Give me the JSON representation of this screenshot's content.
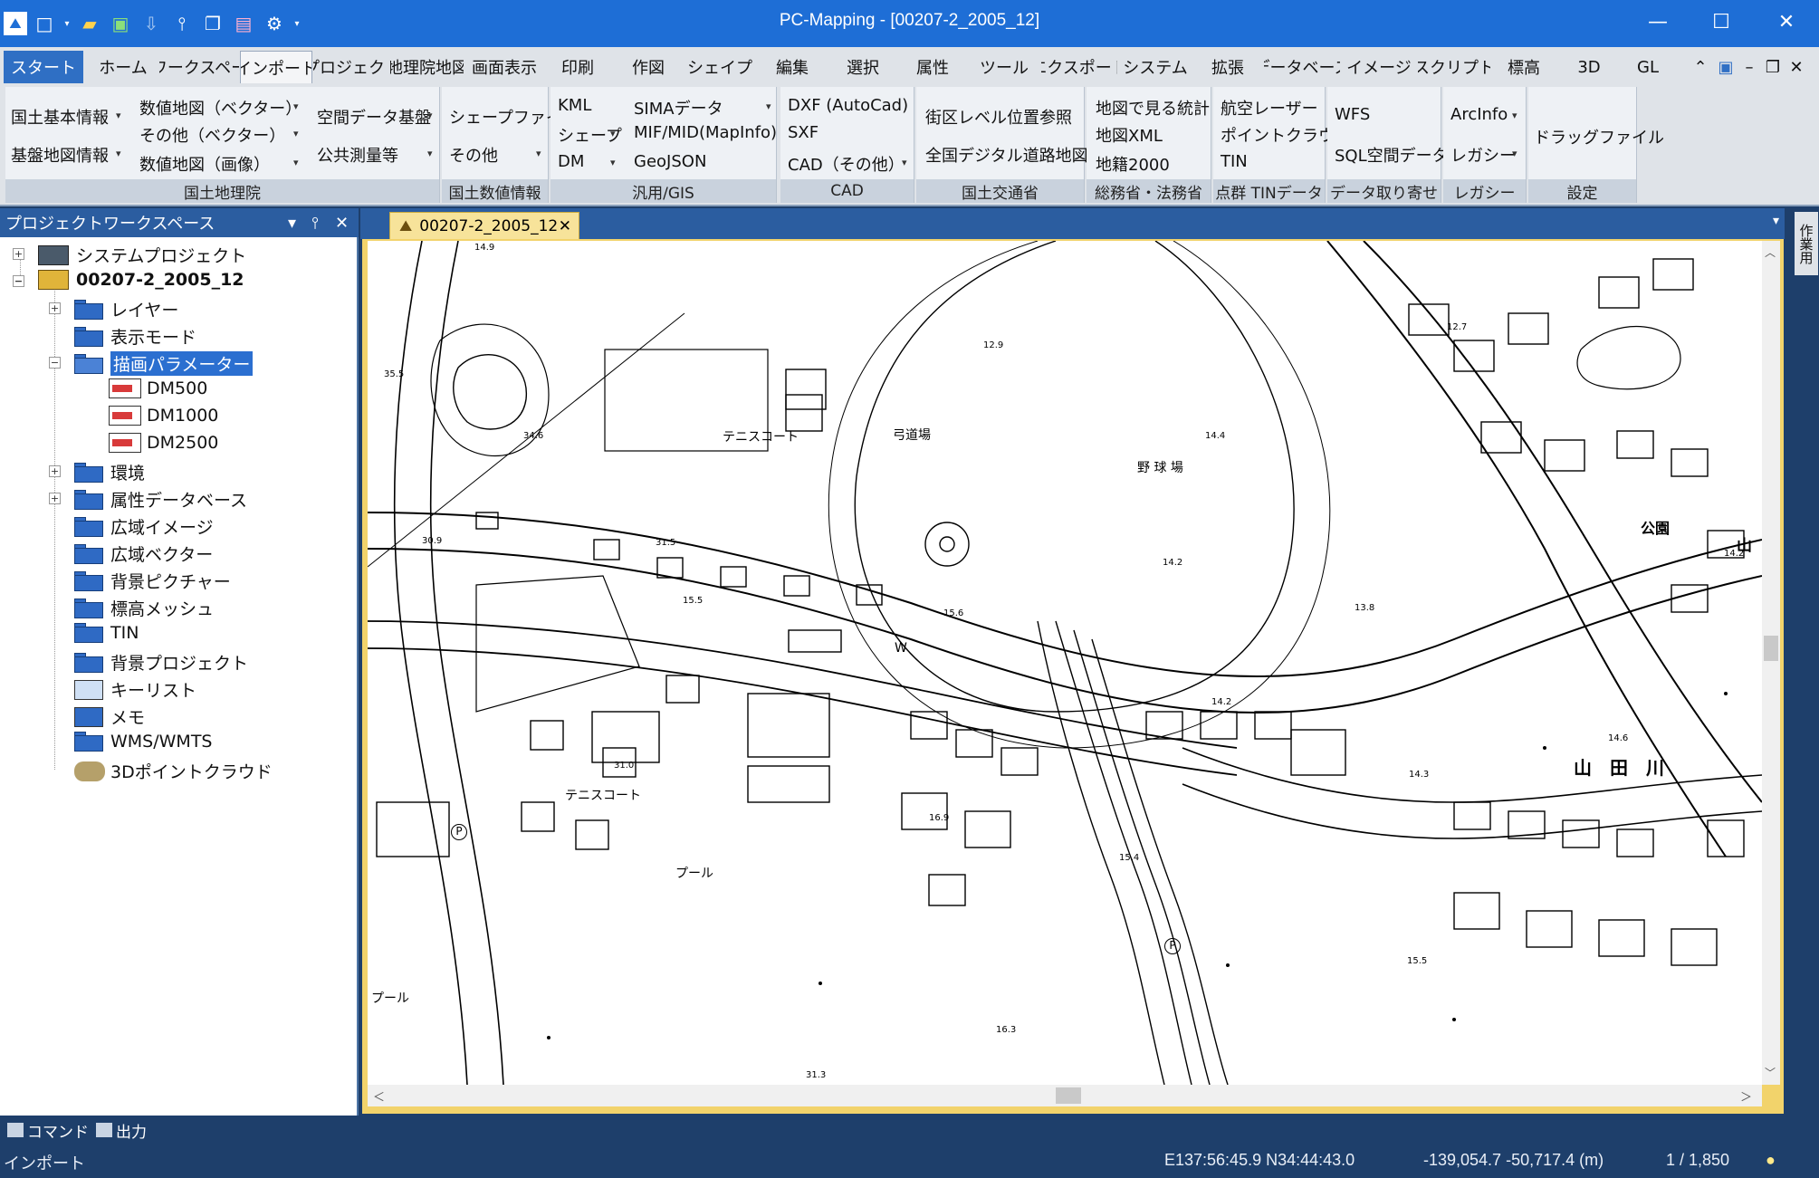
{
  "window": {
    "title": "PC-Mapping - [00207-2_2005_12]"
  },
  "qat": [
    "app-logo-icon",
    "new-file-icon",
    "open-folder-icon",
    "excel-icon",
    "download-icon",
    "pin-icon",
    "copy-icon",
    "print-icon",
    "gear-icon"
  ],
  "tabs": [
    "スタート",
    "ホーム",
    "ワークスペー",
    "インポート",
    "プロジェクト",
    "地理院地図",
    "画面表示",
    "印刷",
    "作図",
    "シェイプ",
    "編集",
    "選択",
    "属性",
    "ツール",
    "エクスポート",
    "システム",
    "拡張",
    "データベース",
    "イメージ",
    "スクリプト",
    "標高",
    "3D",
    "GL"
  ],
  "active_tab": "インポート",
  "ribbon": {
    "kokudo": {
      "title": "国土地理院",
      "items": [
        "国土基本情報",
        "基盤地図情報",
        "数値地図（ベクター）",
        "その他（ベクター）",
        "数値地図（画像）",
        "空間データ基盤",
        "公共測量等"
      ]
    },
    "kokudo_suuchi": {
      "title": "国土数値情報",
      "items": [
        "シェープファイル",
        "その他"
      ]
    },
    "hanyo": {
      "title": "汎用/GIS",
      "items": [
        "KML",
        "シェープ",
        "DM",
        "SIMAデータ",
        "MIF/MID(MapInfo)",
        "GeoJSON"
      ]
    },
    "cad": {
      "title": "CAD",
      "items": [
        "DXF (AutoCad)",
        "SXF",
        "CAD（その他）"
      ]
    },
    "kotsu": {
      "title": "国土交通省",
      "items": [
        "街区レベル位置参照",
        "全国デジタル道路地図"
      ]
    },
    "somu": {
      "title": "総務省・法務省",
      "items": [
        "地図で見る統計",
        "地図XML",
        "地籍2000"
      ]
    },
    "tengun": {
      "title": "点群 TINデータ",
      "items": [
        "航空レーザー",
        "ポイントクラウド",
        "TIN"
      ]
    },
    "data": {
      "title": "データ取り寄せ",
      "items": [
        "WFS",
        "SQL空間データ"
      ]
    },
    "legacy": {
      "title": "レガシー",
      "items": [
        "ArcInfo",
        "レガシー"
      ]
    },
    "settei": {
      "title": "設定",
      "items": [
        "ドラッグファイル"
      ]
    }
  },
  "workspace": {
    "title": "プロジェクトワークスペース",
    "tree": [
      "システムプロジェクト",
      "00207-2_2005_12",
      "レイヤー",
      "表示モード",
      "描画パラメーター",
      "DM500",
      "DM1000",
      "DM2500",
      "環境",
      "属性データベース",
      "広域イメージ",
      "広域ベクター",
      "背景ピクチャー",
      "標高メッシュ",
      "TIN",
      "背景プロジェクト",
      "キーリスト",
      "メモ",
      "WMS/WMTS",
      "3Dポイントクラウド"
    ]
  },
  "doc_tab": "00207-2_2005_12",
  "side_panel": "作業用",
  "map_labels": {
    "tennis1": "テニスコート",
    "kyudo": "弓道場",
    "yakyu": "野 球 場",
    "tennis2": "テニスコート",
    "pool1": "プール",
    "pool2": "プール",
    "koen": "公園",
    "yamada": "山　田　川",
    "yama": "山",
    "w": "W",
    "p": "P",
    "e1": "34.6",
    "e2": "14.4",
    "e3": "14.2",
    "e4": "15.5",
    "e5": "15.6",
    "e6": "31.0",
    "e7": "16.9",
    "e8": "15.4",
    "e9": "14.6",
    "e10": "14.3",
    "e11": "15.5",
    "e12": "16.3",
    "e13": "31.3",
    "e14": "14.2",
    "e15": "12.7",
    "e16": "13.8",
    "e17": "14.2",
    "e18": "12.9",
    "e19": "14.9",
    "e20": "31.5",
    "e21": "30.9",
    "e22": "35.5"
  },
  "bottom_tabs": [
    "コマンド",
    "出力"
  ],
  "status": {
    "mode": "インポート",
    "lonlat": "E137:56:45.9 N34:44:43.0",
    "xy": "-139,054.7 -50,717.4 (m)",
    "scale": "1 / 1,850"
  }
}
